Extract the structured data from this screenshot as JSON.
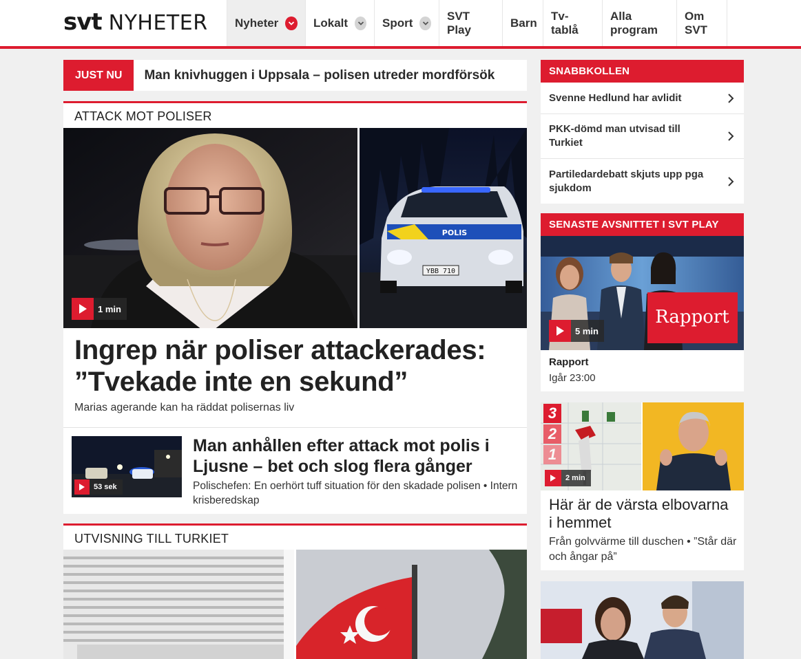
{
  "header": {
    "logo_svt": "svt",
    "logo_nyheter": "NYHETER",
    "nav": [
      {
        "label": "Nyheter",
        "dropdown": true,
        "active": true
      },
      {
        "label": "Lokalt",
        "dropdown": true
      },
      {
        "label": "Sport",
        "dropdown": true
      },
      {
        "label": "SVT Play"
      },
      {
        "label": "Barn"
      },
      {
        "label": "Tv-tablå"
      },
      {
        "label": "Alla program"
      },
      {
        "label": "Om SVT"
      }
    ]
  },
  "justnu": {
    "tag": "JUST NU",
    "text": "Man knivhuggen i Uppsala – polisen utreder mordförsök"
  },
  "main_story": {
    "kicker": "ATTACK MOT POLISER",
    "video_duration": "1 min",
    "headline": "Ingrep när poliser attackerades: ”Tvekade inte en sekund”",
    "subline": "Marias agerande kan ha räddat polisernas liv",
    "related": {
      "video_duration": "53 sek",
      "headline": "Man anhållen efter attack mot polis i Ljusne – bet och slog flera gånger",
      "subline": "Polischefen: En oerhört tuff situation för den skadade polisen • Intern krisberedskap"
    },
    "car_plate": "YBB 710",
    "car_text": "POLIS"
  },
  "second_story": {
    "kicker": "UTVISNING TILL TURKIET"
  },
  "snabbkollen": {
    "title": "SNABBKOLLEN",
    "items": [
      "Svenne Hedlund har avlidit",
      "PKK-dömd man utvisad till Turkiet",
      "Partiledardebatt skjuts upp pga sjukdom"
    ]
  },
  "svtplay": {
    "title": "SENASTE AVSNITTET I SVT PLAY",
    "video_duration": "5 min",
    "overlay_logo": "Rapport",
    "program": "Rapport",
    "time": "Igår 23:00"
  },
  "elbov": {
    "countdown": [
      "3",
      "2",
      "1"
    ],
    "video_duration": "2 min",
    "headline": "Här är de värsta elbovarna i hemmet",
    "subline": "Från golvvärme till duschen • ”Står där och ångar på”"
  },
  "colors": {
    "brand_red": "#dd1c2f",
    "background": "#f0f0f0"
  }
}
